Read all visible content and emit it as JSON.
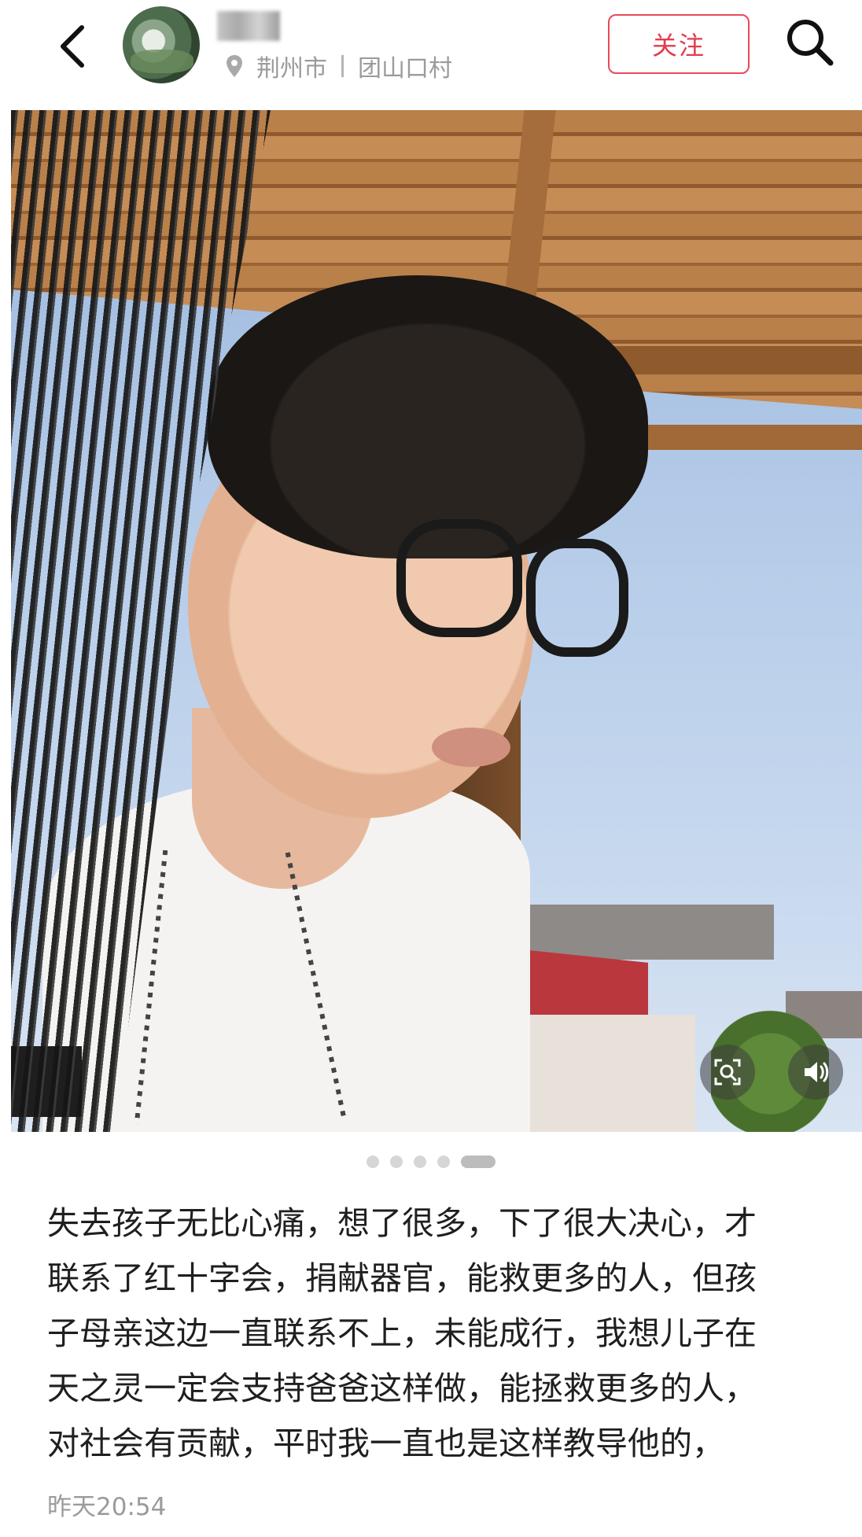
{
  "header": {
    "username": "荆州",
    "location": {
      "city": "荆州市",
      "place": "团山口村"
    },
    "follow_label": "关注"
  },
  "post": {
    "carousel": {
      "total": 5,
      "active_index": 4
    },
    "caption_lines": [
      "失去孩子无比心痛，想了很多，下了很大决心，才",
      "联系了红十字会，捐献器官，能救更多的人，但孩",
      "子母亲这边一直联系不上，未能成行，我想儿子在",
      "天之灵一定会支持爸爸这样做，能拯救更多的人，",
      "对社会有贡献，平时我一直也是这样教导他的，"
    ],
    "time": "昨天20:54"
  },
  "icons": {
    "back": "chevron-left-icon",
    "search": "search-icon",
    "location": "location-pin-icon",
    "scan": "image-scan-icon",
    "sound": "speaker-icon"
  },
  "colors": {
    "accent": "#e23b4e",
    "muted": "#9b9b9b"
  }
}
